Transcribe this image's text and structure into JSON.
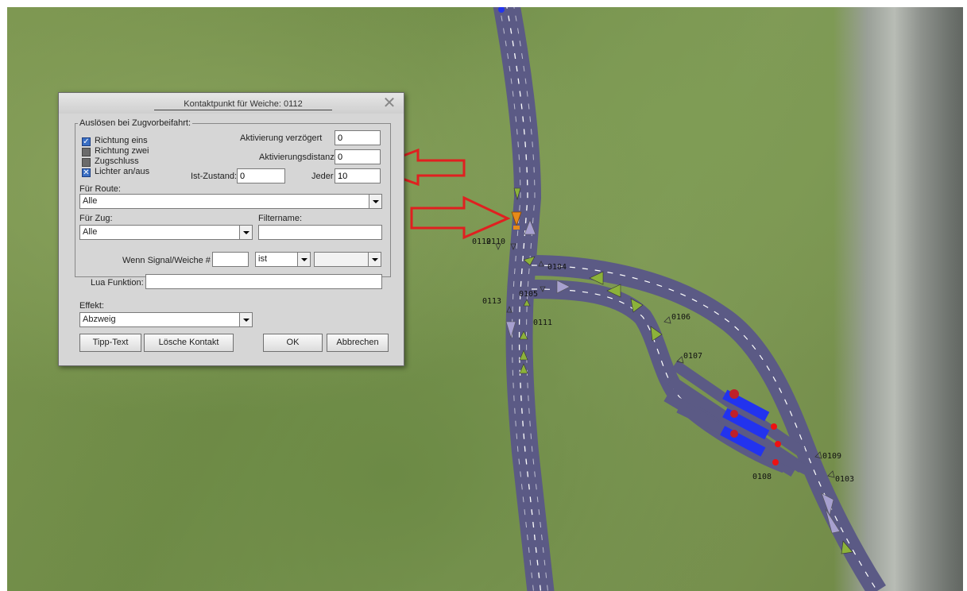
{
  "dialog": {
    "title": "Kontaktpunkt für Weiche: 0112",
    "group_label": "Auslösen bei Zugvorbeifahrt:",
    "checkboxes": [
      {
        "label": "Richtung eins",
        "checked": true
      },
      {
        "label": "Richtung zwei",
        "checked": false
      },
      {
        "label": "Zugschluss",
        "checked": false
      },
      {
        "label": "Lichter an/aus",
        "checked": true
      }
    ],
    "aktivierung_verzoegert": {
      "label": "Aktivierung verzögert",
      "value": "0"
    },
    "aktivierungsdistanz": {
      "label": "Aktivierungsdistanz",
      "value": "0"
    },
    "ist_zustand": {
      "label": "Ist-Zustand:",
      "value": "0"
    },
    "jeder": {
      "label": "Jeder",
      "value": "10"
    },
    "route": {
      "label": "Für Route:",
      "value": "Alle"
    },
    "zug": {
      "label": "Für Zug:",
      "value": "Alle"
    },
    "filtername": {
      "label": "Filtername:",
      "value": ""
    },
    "signal": {
      "label": "Wenn Signal/Weiche #",
      "value": "",
      "op": "ist",
      "state": ""
    },
    "lua": {
      "label": "Lua Funktion:",
      "value": ""
    },
    "effekt": {
      "label": "Effekt:",
      "value": "Abzweig"
    },
    "buttons": {
      "tipp": "Tipp-Text",
      "loesche": "Lösche Kontakt",
      "ok": "OK",
      "abbrechen": "Abbrechen"
    }
  },
  "map_labels": {
    "l0112": "0112",
    "l0110": "0110",
    "l0104": "0104",
    "l0105": "0105",
    "l0113": "0113",
    "l0111": "0111",
    "l0106": "0106",
    "l0107": "0107",
    "l0109": "0109",
    "l0103": "0103",
    "l0108": "0108"
  },
  "colors": {
    "road": "#5b5a85",
    "arrow_annotation": "#e02020",
    "selected_contact": "#e88a1a",
    "contact_green": "#8cb23a",
    "signal_lilac": "#a7a0cf"
  }
}
